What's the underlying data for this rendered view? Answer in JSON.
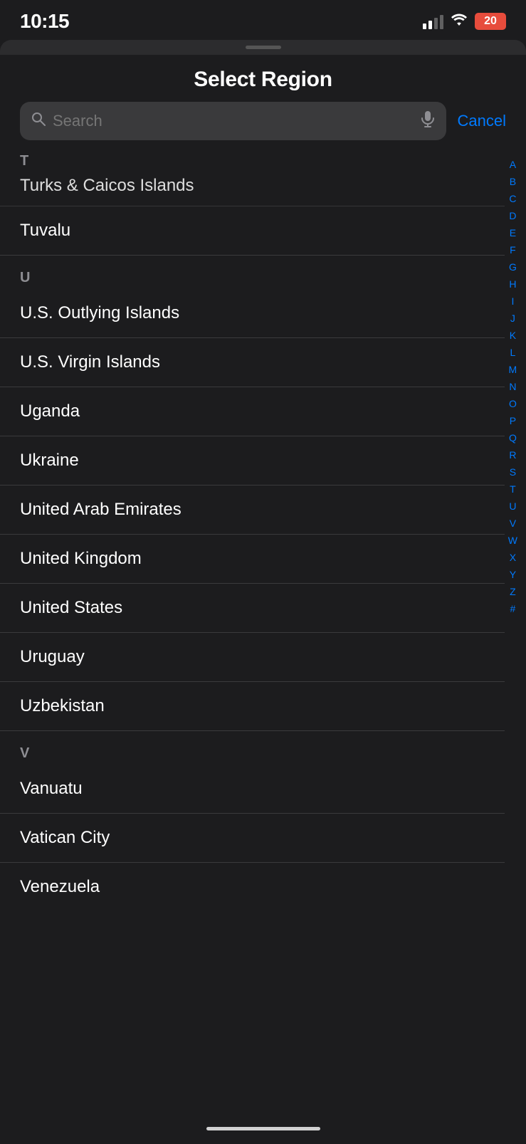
{
  "statusBar": {
    "time": "10:15",
    "battery": "20"
  },
  "header": {
    "title": "Select Region"
  },
  "search": {
    "placeholder": "Search",
    "cancel_label": "Cancel"
  },
  "sections": [
    {
      "letter": "T",
      "items": [
        {
          "name": "Turks & Caicos Islands",
          "partial": true
        },
        {
          "name": "Tuvalu",
          "partial": false
        }
      ]
    },
    {
      "letter": "U",
      "items": [
        {
          "name": "U.S. Outlying Islands"
        },
        {
          "name": "U.S. Virgin Islands"
        },
        {
          "name": "Uganda"
        },
        {
          "name": "Ukraine"
        },
        {
          "name": "United Arab Emirates"
        },
        {
          "name": "United Kingdom"
        },
        {
          "name": "United States"
        },
        {
          "name": "Uruguay"
        },
        {
          "name": "Uzbekistan"
        }
      ]
    },
    {
      "letter": "V",
      "items": [
        {
          "name": "Vanuatu"
        },
        {
          "name": "Vatican City"
        },
        {
          "name": "Venezuela",
          "partial": true
        }
      ]
    }
  ],
  "alphabetIndex": [
    "A",
    "B",
    "C",
    "D",
    "E",
    "F",
    "G",
    "H",
    "I",
    "J",
    "K",
    "L",
    "M",
    "N",
    "O",
    "P",
    "Q",
    "R",
    "S",
    "T",
    "U",
    "V",
    "W",
    "X",
    "Y",
    "Z",
    "#"
  ]
}
